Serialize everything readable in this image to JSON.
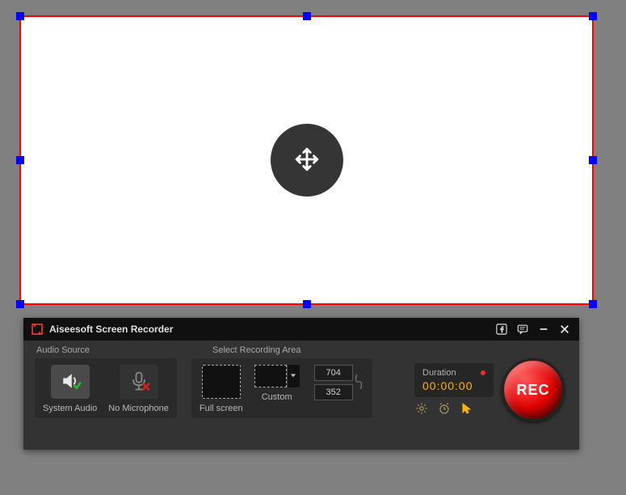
{
  "app": {
    "title": "Aiseesoft Screen Recorder"
  },
  "sections": {
    "audio_label": "Audio Source",
    "area_label": "Select Recording Area"
  },
  "audio": {
    "system": "System Audio",
    "microphone": "No Microphone"
  },
  "area": {
    "fullscreen": "Full screen",
    "custom": "Custom",
    "width": "704",
    "height": "352"
  },
  "duration": {
    "label": "Duration",
    "time": "00:00:00"
  },
  "rec": {
    "label": "REC"
  }
}
